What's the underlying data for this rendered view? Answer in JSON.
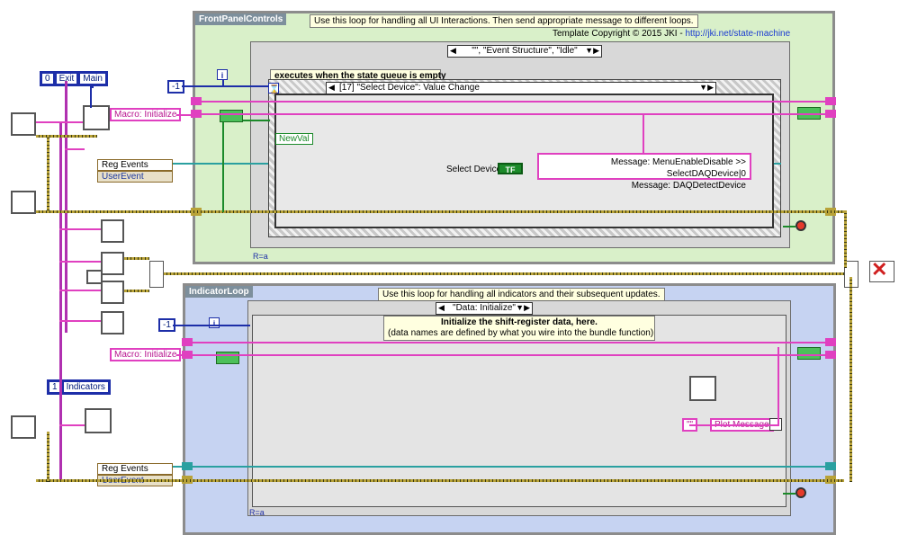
{
  "colors": {
    "frontpanel_loop": "#d9f0c9",
    "indicator_loop": "#c6d3f2",
    "string_wire": "#e040c0",
    "error_wire": "#b8a238",
    "event_wire": "#2aa0a0",
    "numeric_wire": "#1d2ea8",
    "boolean_wire": "#1c8a2a"
  },
  "frontpanel_loop": {
    "label": "FrontPanelControls",
    "note": "Use this loop for handling all UI Interactions. Then send appropriate message to different loops.",
    "copyright_prefix": "Template Copyright © 2015 JKI - ",
    "copyright_link": "http://jki.net/state-machine",
    "case_selector": "\"\", \"Event Structure\", \"Idle\"",
    "event_note": "executes when the state queue is empty",
    "event_selector": "[17] \"Select Device\": Value Change",
    "newval_label": "NewVal",
    "select_device_label": "Select Device",
    "tf_label": "TF",
    "message_lines": [
      "Message: MenuEnableDisable >> SelectDAQDevice|0",
      "Message: DAQDetectDevice"
    ],
    "timeout_const": "-1",
    "iter_label": "i",
    "macro_label": "Macro: Initialize",
    "reg_events": "Reg Events",
    "user_event": "UserEvent"
  },
  "indicator_loop": {
    "label": "IndicatorLoop",
    "note": "Use this loop for handling all indicators and their subsequent updates.",
    "case_selector": "\"Data: Initialize\"",
    "init_note_title": "Initialize the shift-register data, here.",
    "init_note_sub": "(data names are defined by what you wire into the bundle function)",
    "plot_message": "Plot Message",
    "empty_string": "\"\"",
    "timeout_const": "-1",
    "iter_label": "i",
    "macro_label": "Macro: Initialize",
    "reg_events": "Reg Events",
    "user_event": "UserEvent"
  },
  "top_ring": {
    "index": "0",
    "item1": "Exit",
    "item2": "Main"
  },
  "bottom_ring": {
    "index": "1",
    "item1": "Indicators"
  },
  "iteration_marker": "R=a",
  "icons": {
    "queue": "envelope-queue-icon",
    "merge": "build-array-icon",
    "error_handler": "error-handler-icon",
    "stop": "stop-button-icon"
  }
}
